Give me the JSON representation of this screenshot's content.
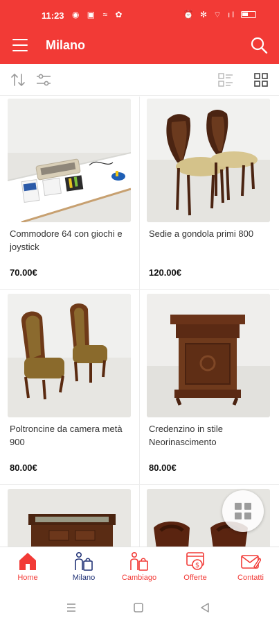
{
  "status_bar": {
    "time": "11:23",
    "notification_icons": "◉ ▣ ≈ ✿",
    "system_icons": "⏰ ✻ ⌔ ıl"
  },
  "app_bar": {
    "title": "Milano"
  },
  "listings": [
    {
      "title": "Commodore 64 con giochi e joystick",
      "price": "70.00€"
    },
    {
      "title": "Sedie a gondola primi 800",
      "price": "120.00€"
    },
    {
      "title": "Poltroncine da camera metà 900",
      "price": "80.00€"
    },
    {
      "title": "Credenzino in stile Neorinascimento",
      "price": "80.00€"
    },
    {
      "title": "",
      "price": ""
    },
    {
      "title": "",
      "price": ""
    }
  ],
  "bottom_nav": [
    {
      "label": "Home",
      "icon": "home-icon"
    },
    {
      "label": "Milano",
      "icon": "city-bag-icon"
    },
    {
      "label": "Cambiago",
      "icon": "city-bag-icon"
    },
    {
      "label": "Offerte",
      "icon": "offers-icon"
    },
    {
      "label": "Contatti",
      "icon": "mail-icon"
    }
  ],
  "colors": {
    "brand": "#f23a36",
    "active_nav": "#223377"
  }
}
